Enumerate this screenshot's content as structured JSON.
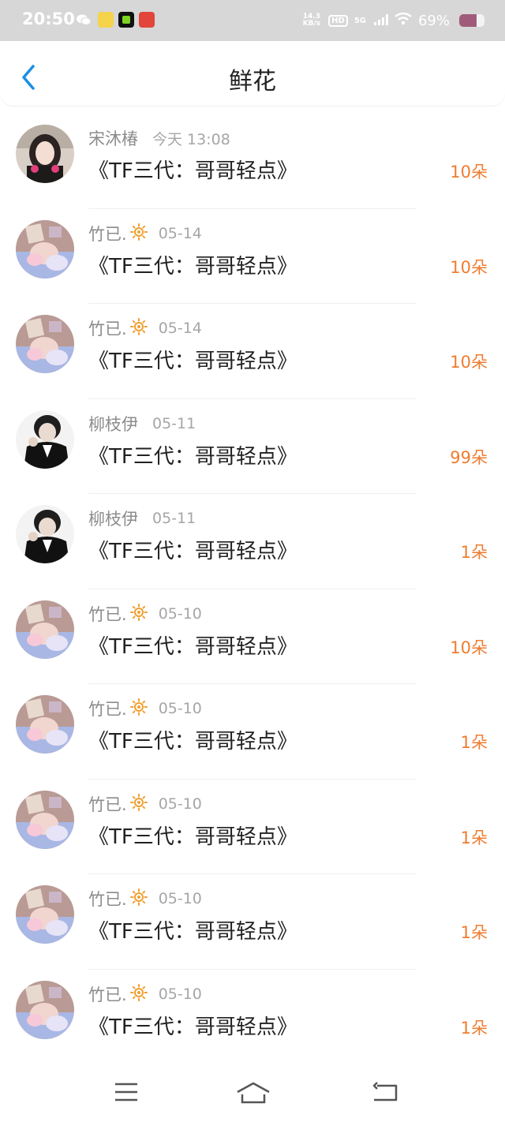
{
  "status_bar": {
    "time": "20:50",
    "net_speed_top": "14.3",
    "net_speed_unit": "KB/s",
    "hd": "HD",
    "network": "5G",
    "battery": "69%",
    "battery_level": 0.69,
    "notification_icons": [
      "wechat-icon",
      "app-icon",
      "app-icon-green",
      "app-icon-red"
    ]
  },
  "header": {
    "title": "鲜花",
    "back_icon": "chevron-left-icon",
    "accent_color": "#1a8fe3"
  },
  "items": [
    {
      "name": "宋沐椿",
      "sun": false,
      "date": "今天 13:08",
      "book": "《TF三代：哥哥轻点》",
      "count": "10朵",
      "avatar": "girl"
    },
    {
      "name": "竹已.",
      "sun": true,
      "date": "05-14",
      "book": "《TF三代：哥哥轻点》",
      "count": "10朵",
      "avatar": "baby"
    },
    {
      "name": "竹已.",
      "sun": true,
      "date": "05-14",
      "book": "《TF三代：哥哥轻点》",
      "count": "10朵",
      "avatar": "baby"
    },
    {
      "name": "柳枝伊",
      "sun": false,
      "date": "05-11",
      "book": "《TF三代：哥哥轻点》",
      "count": "99朵",
      "avatar": "boy"
    },
    {
      "name": "柳枝伊",
      "sun": false,
      "date": "05-11",
      "book": "《TF三代：哥哥轻点》",
      "count": "1朵",
      "avatar": "boy"
    },
    {
      "name": "竹已.",
      "sun": true,
      "date": "05-10",
      "book": "《TF三代：哥哥轻点》",
      "count": "10朵",
      "avatar": "baby"
    },
    {
      "name": "竹已.",
      "sun": true,
      "date": "05-10",
      "book": "《TF三代：哥哥轻点》",
      "count": "1朵",
      "avatar": "baby"
    },
    {
      "name": "竹已.",
      "sun": true,
      "date": "05-10",
      "book": "《TF三代：哥哥轻点》",
      "count": "1朵",
      "avatar": "baby"
    },
    {
      "name": "竹已.",
      "sun": true,
      "date": "05-10",
      "book": "《TF三代：哥哥轻点》",
      "count": "1朵",
      "avatar": "baby"
    },
    {
      "name": "竹已.",
      "sun": true,
      "date": "05-10",
      "book": "《TF三代：哥哥轻点》",
      "count": "1朵",
      "avatar": "baby"
    }
  ],
  "colors": {
    "count": "#ef7c2f",
    "name": "#8c8c8c",
    "date": "#a6a6a6",
    "sun": "#f0a030"
  },
  "nav": {
    "menu_icon": "menu-icon",
    "home_icon": "home-icon",
    "back_icon": "back-icon"
  }
}
